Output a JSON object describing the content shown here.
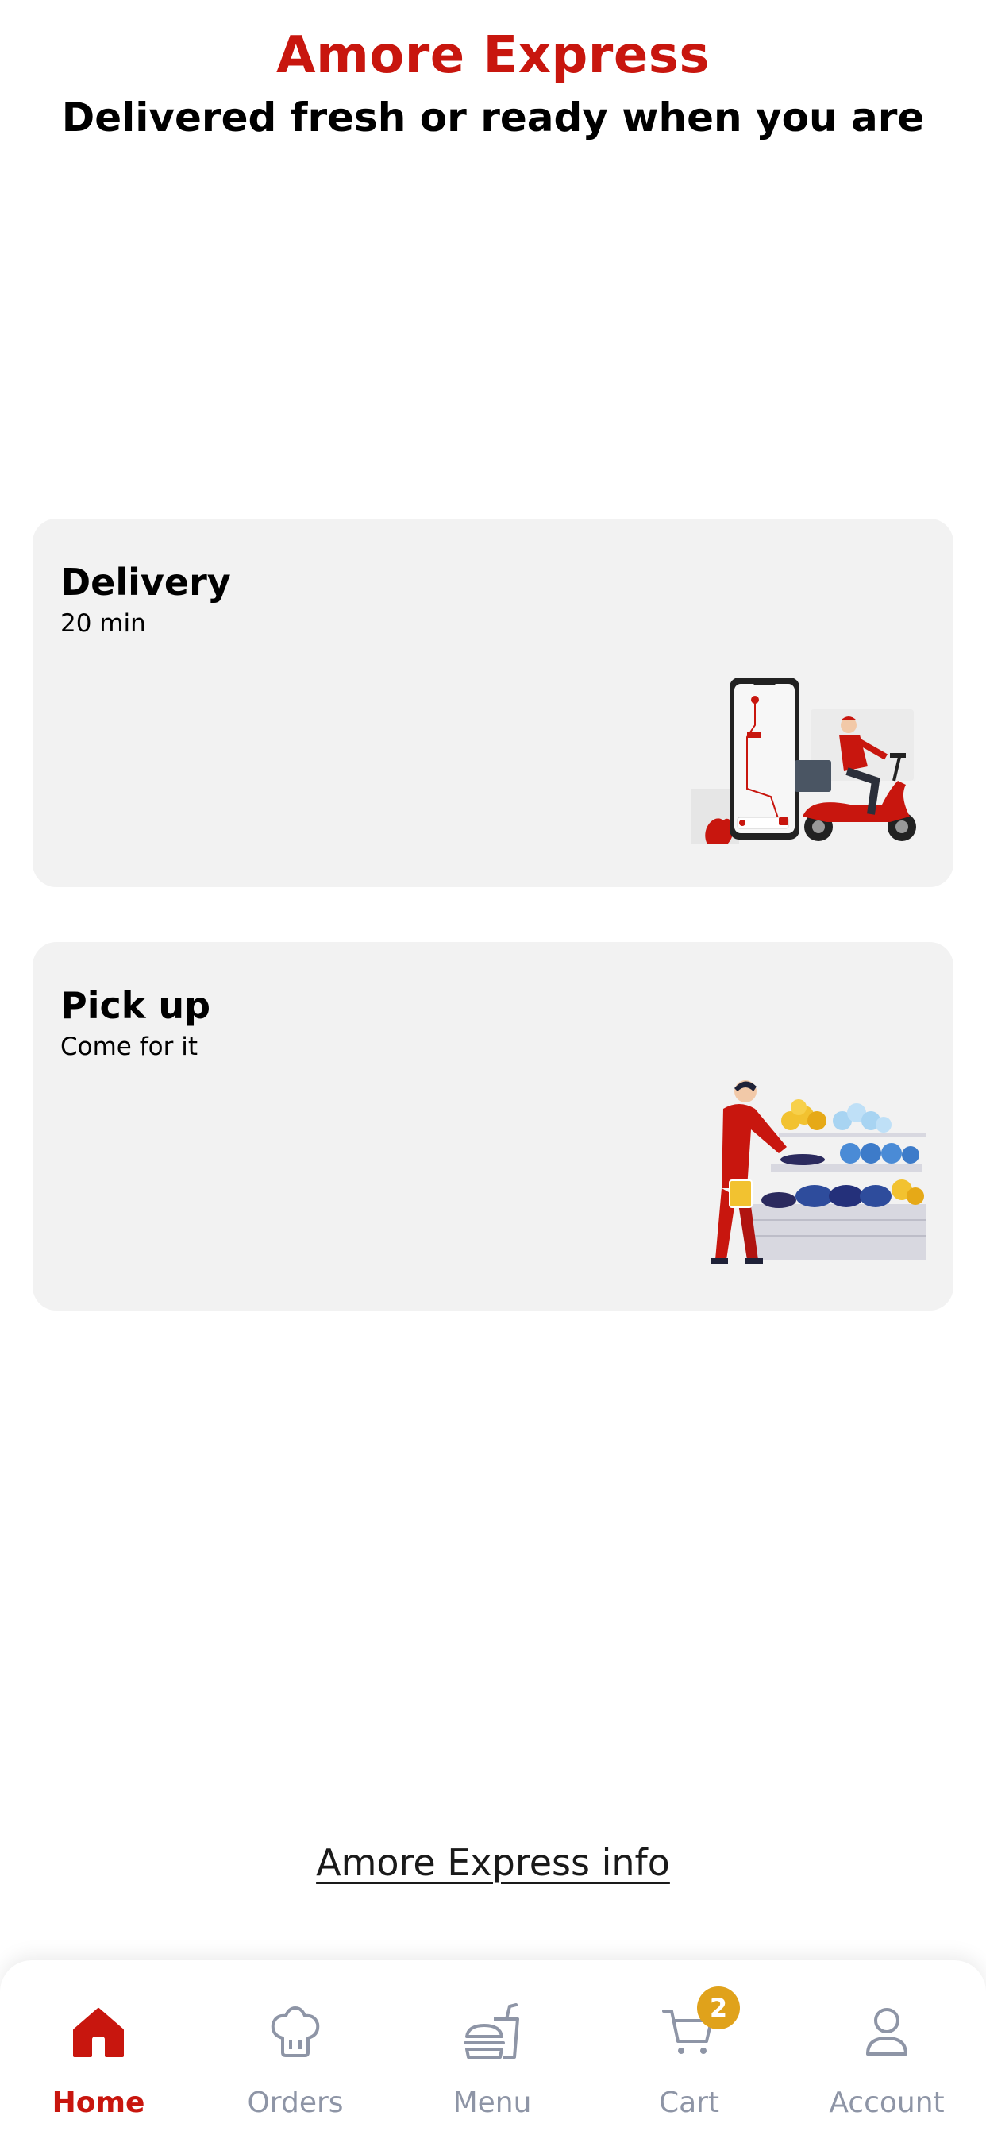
{
  "header": {
    "title": "Amore Express",
    "tagline": "Delivered fresh or ready when you are"
  },
  "options": {
    "delivery": {
      "title": "Delivery",
      "subtitle": "20 min",
      "illustration": "delivery-scooter-illustration"
    },
    "pickup": {
      "title": "Pick up",
      "subtitle": "Come for it",
      "illustration": "grocery-pickup-illustration"
    }
  },
  "footer": {
    "info_link": "Amore Express info"
  },
  "nav": {
    "items": [
      {
        "label": "Home",
        "icon": "home-icon",
        "active": true
      },
      {
        "label": "Orders",
        "icon": "chef-hat-icon",
        "active": false
      },
      {
        "label": "Menu",
        "icon": "burger-drink-icon",
        "active": false
      },
      {
        "label": "Cart",
        "icon": "cart-icon",
        "active": false
      },
      {
        "label": "Account",
        "icon": "user-icon",
        "active": false
      }
    ],
    "cart_count": "2"
  },
  "colors": {
    "brand": "#C8160E",
    "card_bg": "#F2F2F2",
    "nav_inactive": "#8E95A6",
    "badge": "#E0A21B"
  }
}
